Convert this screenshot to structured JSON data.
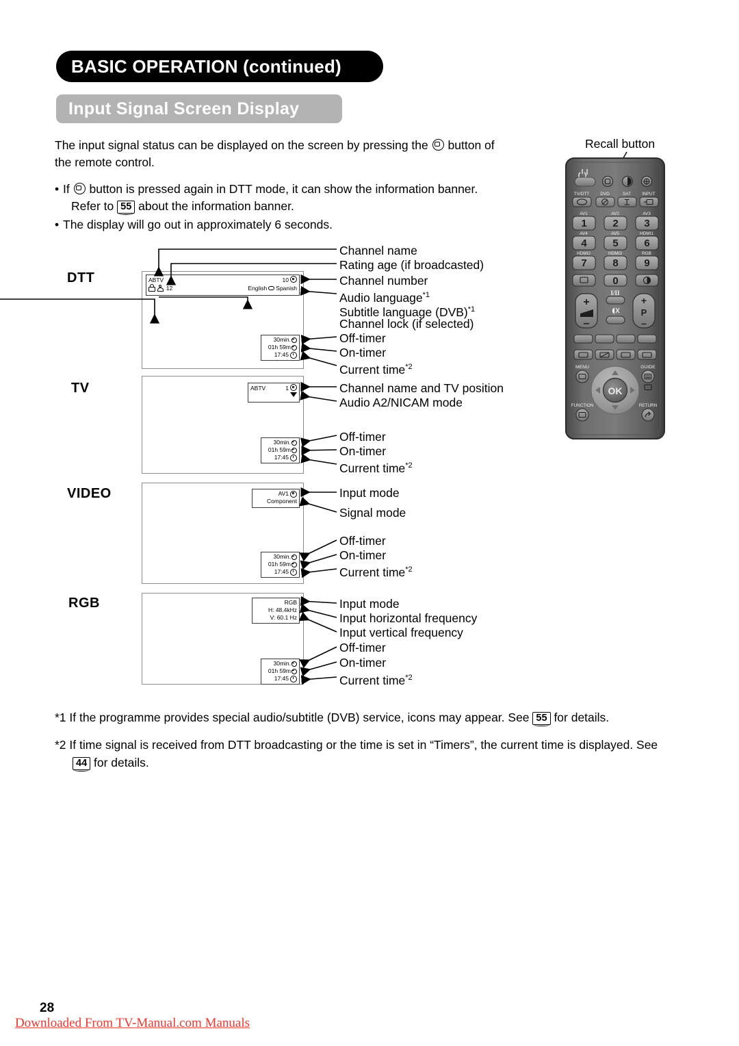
{
  "header": {
    "chapter_pill": "BASIC OPERATION (continued)",
    "section_pill": "Input Signal Screen Display"
  },
  "intro": {
    "line1": "The input signal status can be displayed on the screen by pressing the",
    "line1_tail": "button of",
    "line2": "the remote control.",
    "bullet1_a": "If",
    "bullet1_b": "button is pressed again in DTT mode, it can show the information banner.",
    "bullet1_c_pre": "Refer to",
    "bullet1_pageref": "55",
    "bullet1_c_post": "about the information banner.",
    "bullet2": "The display will go out in approximately 6 seconds."
  },
  "remote": {
    "caption": "Recall button",
    "power_symbol": "⏻|",
    "row2_labels": [
      "TV/DTT",
      "DVD",
      "SAT",
      "INPUT"
    ],
    "num_top_labels": [
      "AV1",
      "AV2",
      "AV3"
    ],
    "num_mid_labels": [
      "AV4",
      "AV5",
      "HDMI1"
    ],
    "num_bot_labels": [
      "HDMI2",
      "HDMI3",
      "RGB"
    ],
    "numbers_row1": [
      "1",
      "2",
      "3"
    ],
    "numbers_row2": [
      "4",
      "5",
      "6"
    ],
    "numbers_row3": [
      "7",
      "8",
      "9"
    ],
    "zero": "0",
    "sound_label": "I/II",
    "volume_plus": "+",
    "volume_minus": "–",
    "prog_plus": "+",
    "prog_label": "P",
    "prog_minus": "–",
    "menu_label": "MENU",
    "guide_label": "GUIDE",
    "function_label": "FUNCTION",
    "return_label": "RETURN",
    "ok_label": "OK"
  },
  "sections": [
    {
      "mode": "DTT",
      "osd_main": {
        "channel_name": "ABTV",
        "channel_number": "10",
        "rating_age": "12",
        "audio_language": "English",
        "subtitle_language": "Spanish"
      },
      "osd_timer": {
        "off_timer": "30min.",
        "on_timer": "01h 59m",
        "current_time": "17:45"
      },
      "callouts": [
        "Channel name",
        "Rating age (if broadcasted)",
        "Channel number",
        "Audio language*1",
        "Subtitle language (DVB)*1",
        "Channel lock (if selected)",
        "Off-timer",
        "On-timer",
        "Current time*2"
      ]
    },
    {
      "mode": "TV",
      "osd_main": {
        "channel_name": "ABTV",
        "tv_position": "1"
      },
      "osd_timer": {
        "off_timer": "30min.",
        "on_timer": "01h 59m",
        "current_time": "17:45"
      },
      "callouts": [
        "Channel name and TV position",
        "Audio A2/NICAM mode",
        "Off-timer",
        "On-timer",
        "Current time*2"
      ]
    },
    {
      "mode": "VIDEO",
      "osd_main": {
        "input_mode": "AV1",
        "signal_mode": "Component"
      },
      "osd_timer": {
        "off_timer": "30min.",
        "on_timer": "01h 59m",
        "current_time": "17:45"
      },
      "callouts": [
        "Input mode",
        "Signal mode",
        "Off-timer",
        "On-timer",
        "Current time*2"
      ]
    },
    {
      "mode": "RGB",
      "osd_main": {
        "input_mode": "RGB",
        "h_freq": "H:  48.4kHz",
        "v_freq": "V:  60.1  Hz"
      },
      "osd_timer": {
        "off_timer": "30min.",
        "on_timer": "01h 59m",
        "current_time": "17:45"
      },
      "callouts": [
        "Input mode",
        "Input horizontal frequency",
        "Input vertical frequency",
        "Off-timer",
        "On-timer",
        "Current time*2"
      ]
    }
  ],
  "footnotes": {
    "fn1_a": "*1 If the programme provides special audio/subtitle (DVB) service, icons may appear. See",
    "fn1_ref": "55",
    "fn1_b": "for details.",
    "fn2_a": "*2 If time signal is received from DTT broadcasting or the time is set in “Timers”, the current time is displayed. See",
    "fn2_ref": "44",
    "fn2_b": "for details."
  },
  "footer": {
    "page_number": "28",
    "download_text": "Downloaded From TV-Manual.com Manuals"
  },
  "colors": {
    "chapter_pill_bg": "#000000",
    "section_pill_bg": "#b3b3b3",
    "footer_link": "#f0362e",
    "screen_border": "#8a8a8a"
  }
}
